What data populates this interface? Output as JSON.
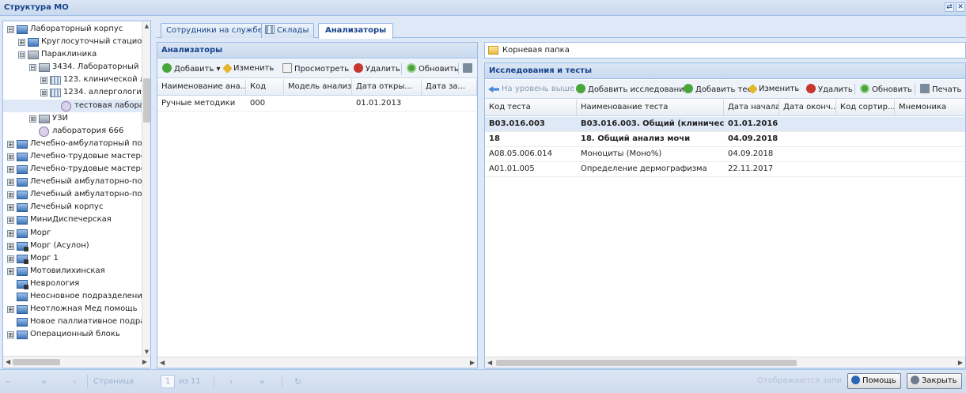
{
  "window": {
    "title": "Структура МО",
    "btn_refresh": "⇄",
    "btn_close": "✕"
  },
  "tree": {
    "nodes": [
      {
        "label": "Лабораторный корпус",
        "exp": "⊟",
        "icon": "folder-icon",
        "level": 0
      },
      {
        "label": "Круглосуточный стациона",
        "exp": "⊞",
        "icon": "folder-icon",
        "level": 1
      },
      {
        "label": "Параклиника",
        "exp": "⊟",
        "icon": "building-icon",
        "level": 1
      },
      {
        "label": "3434. Лабораторный к",
        "exp": "⊟",
        "icon": "building-icon",
        "level": 2
      },
      {
        "label": "123. клинической л",
        "exp": "⊞",
        "icon": "grid-icon",
        "level": 3
      },
      {
        "label": "1234. аллергологии",
        "exp": "⊞",
        "icon": "grid-icon",
        "level": 3
      },
      {
        "label": "тестовая лаборатор",
        "exp": "",
        "icon": "lab-icon",
        "level": 4,
        "selected": true
      },
      {
        "label": "УЗИ",
        "exp": "⊞",
        "icon": "building-icon",
        "level": 2
      },
      {
        "label": "лаборатория 666",
        "exp": "",
        "icon": "lab-icon",
        "level": 2
      },
      {
        "label": "Лечебно-амбулаторный поли",
        "exp": "⊞",
        "icon": "folder-icon",
        "level": 0
      },
      {
        "label": "Лечебно-трудовые мастерск",
        "exp": "⊞",
        "icon": "folder-icon",
        "level": 0
      },
      {
        "label": "Лечебно-трудовые мастерск",
        "exp": "⊞",
        "icon": "folder-icon",
        "level": 0
      },
      {
        "label": "Лечебный амбулаторно-поли",
        "exp": "⊞",
        "icon": "folder-icon",
        "level": 0
      },
      {
        "label": "Лечебный амбулаторно-поли",
        "exp": "⊞",
        "icon": "folder-icon",
        "level": 0
      },
      {
        "label": "Лечебный корпус",
        "exp": "⊞",
        "icon": "folder-icon",
        "level": 0
      },
      {
        "label": "МиниДиспечерская",
        "exp": "⊞",
        "icon": "folder-icon",
        "level": 0
      },
      {
        "label": "Морг",
        "exp": "⊞",
        "icon": "folder-icon",
        "level": 0
      },
      {
        "label": "Морг (Асулон)",
        "exp": "⊞",
        "icon": "lock-folder-icon",
        "level": 0
      },
      {
        "label": "Морг 1",
        "exp": "⊞",
        "icon": "lock-folder-icon",
        "level": 0
      },
      {
        "label": "Мотовилихинская",
        "exp": "⊞",
        "icon": "folder-icon",
        "level": 0
      },
      {
        "label": "Неврология",
        "exp": "",
        "icon": "lock-folder-icon",
        "level": 0
      },
      {
        "label": "Неосновное подразделение",
        "exp": "",
        "icon": "folder-icon",
        "level": 0
      },
      {
        "label": "Неотложная Мед помощь",
        "exp": "⊞",
        "icon": "folder-icon",
        "level": 0
      },
      {
        "label": "Новое паллиативное подраз",
        "exp": "",
        "icon": "folder-icon",
        "level": 0
      },
      {
        "label": "Операционный блокь",
        "exp": "⊞",
        "icon": "folder-icon",
        "level": 0
      }
    ]
  },
  "tabs": [
    {
      "label": "Сотрудники на службе"
    },
    {
      "label": "Склады"
    },
    {
      "label": "Анализаторы"
    }
  ],
  "analyzers": {
    "title": "Анализаторы",
    "toolbar": {
      "add": "Добавить",
      "edit": "Изменить",
      "view": "Просмотреть",
      "delete": "Удалить",
      "refresh": "Обновить"
    },
    "columns": [
      "Наименование ана...",
      "Код",
      "Модель анализ...",
      "Дата откры...",
      "Дата за..."
    ],
    "rows": [
      [
        "Ручные методики",
        "000",
        "",
        "01.01.2013",
        ""
      ]
    ]
  },
  "folder": {
    "label": "Корневая папка"
  },
  "tests": {
    "title": "Исследования и тесты",
    "toolbar": {
      "up": "На уровень выше",
      "add_study": "Добавить исследование",
      "add_test": "Добавить тест",
      "edit": "Изменить",
      "delete": "Удалить",
      "refresh": "Обновить",
      "print": "Печать"
    },
    "columns": [
      "Код теста",
      "Наименование теста",
      "Дата начала",
      "Дата оконч...",
      "Код сортир...",
      "Мнемоника"
    ],
    "rows": [
      {
        "cells": [
          "B03.016.003",
          "B03.016.003. Общий (клиническ...",
          "01.01.2016",
          "",
          "",
          ""
        ],
        "bold": true,
        "selected": true
      },
      {
        "cells": [
          "18",
          "18. Общий анализ мочи",
          "04.09.2018",
          "",
          "",
          ""
        ],
        "bold": true
      },
      {
        "cells": [
          "A08.05.006.014",
          "Моноциты (Моно%)",
          "04.09.2018",
          "",
          "",
          ""
        ]
      },
      {
        "cells": [
          "A01.01.005",
          "Определение дермографизма",
          "22.11.2017",
          "",
          "",
          ""
        ]
      }
    ]
  },
  "pager": {
    "page_label": "Страница",
    "page_value": "1",
    "of_label": "из 11",
    "status": "Отображаются запи",
    "help": "Помощь",
    "close": "Закрыть"
  }
}
